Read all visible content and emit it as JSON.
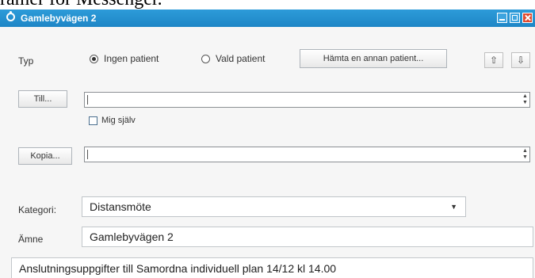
{
  "caption": {
    "text": "ramer för Messenger."
  },
  "window": {
    "title": "Gamlebyvägen 2",
    "controls": {
      "minimize": "minimize-icon",
      "maximize": "maximize-icon",
      "close": "close-icon"
    }
  },
  "type_row": {
    "label": "Typ",
    "options": [
      {
        "label": "Ingen patient",
        "selected": true
      },
      {
        "label": "Vald patient",
        "selected": false
      }
    ],
    "fetch_button": "Hämta en annan patient...",
    "up_arrow": "⇧",
    "down_arrow": "⇩"
  },
  "to_row": {
    "button": "Till...",
    "value": "",
    "self_checkbox_label": "Mig själv",
    "self_checked": false
  },
  "copy_row": {
    "button": "Kopia...",
    "value": ""
  },
  "category": {
    "label": "Kategori:",
    "value": "Distansmöte",
    "dropdown_icon": "▼"
  },
  "subject": {
    "label": "Ämne",
    "value": "Gamlebyvägen 2"
  },
  "message": {
    "first_line": "Anslutningsuppgifter till Samordna individuell plan 14/12 kl 14.00"
  }
}
